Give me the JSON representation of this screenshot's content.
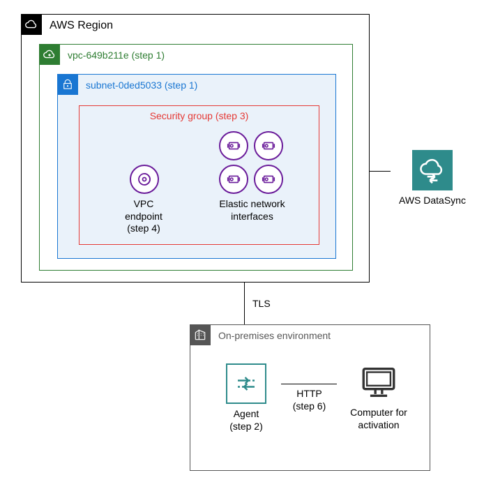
{
  "region": {
    "title": "AWS Region"
  },
  "vpc": {
    "label": "vpc-649b211e (step 1)"
  },
  "subnet": {
    "label": "subnet-0ded5033 (step 1)"
  },
  "security_group": {
    "label": "Security group (step 3)"
  },
  "vpc_endpoint": {
    "label_l1": "VPC",
    "label_l2": "endpoint",
    "label_l3": "(step 4)"
  },
  "eni": {
    "label_l1": "Elastic network",
    "label_l2": "interfaces"
  },
  "datasync": {
    "label": "AWS DataSync"
  },
  "tls": {
    "label": "TLS"
  },
  "onprem": {
    "title": "On-premises environment"
  },
  "agent": {
    "label_l1": "Agent",
    "label_l2": "(step 2)"
  },
  "http": {
    "label_l1": "HTTP",
    "label_l2": "(step 6)"
  },
  "computer": {
    "label_l1": "Computer for",
    "label_l2": "activation"
  }
}
